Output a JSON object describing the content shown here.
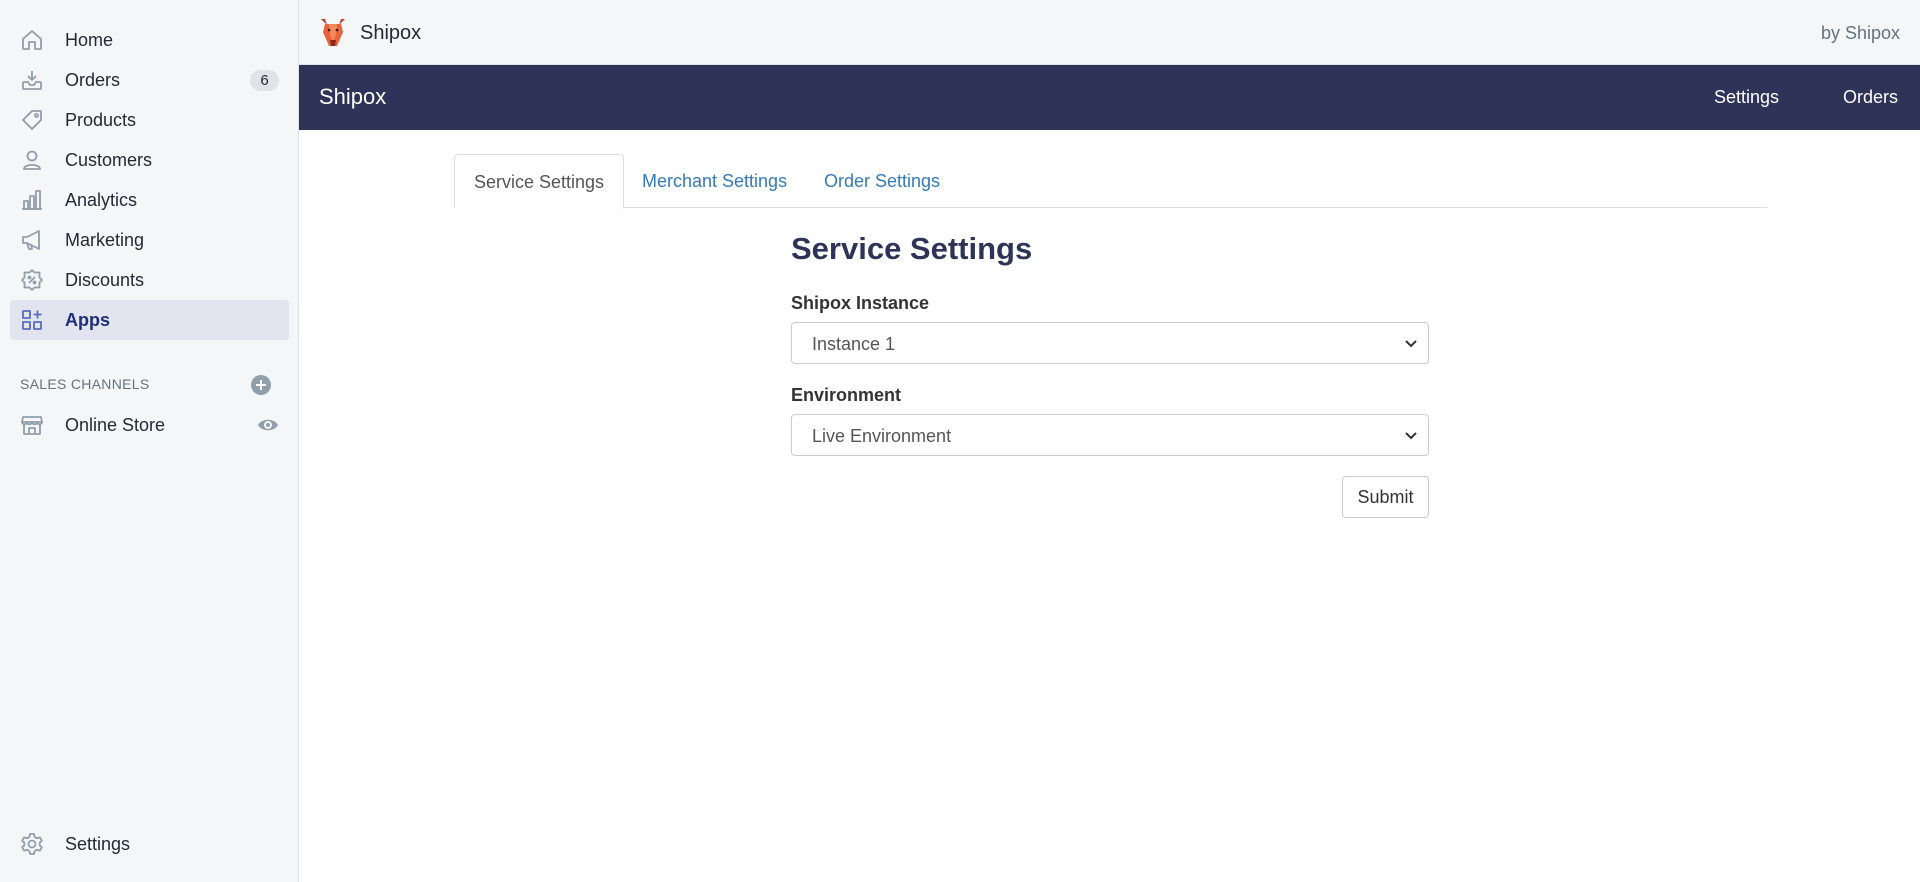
{
  "sidebar": {
    "items": [
      {
        "label": "Home",
        "icon": "home-icon"
      },
      {
        "label": "Orders",
        "icon": "orders-icon",
        "badge": "6"
      },
      {
        "label": "Products",
        "icon": "tag-icon"
      },
      {
        "label": "Customers",
        "icon": "person-icon"
      },
      {
        "label": "Analytics",
        "icon": "bar-chart-icon"
      },
      {
        "label": "Marketing",
        "icon": "megaphone-icon"
      },
      {
        "label": "Discounts",
        "icon": "discount-icon"
      },
      {
        "label": "Apps",
        "icon": "apps-icon",
        "active": true
      }
    ],
    "sales_channels": {
      "title": "SALES CHANNELS",
      "items": [
        {
          "label": "Online Store",
          "icon": "store-icon"
        }
      ]
    },
    "settings_label": "Settings"
  },
  "topbar": {
    "app_name": "Shipox",
    "by_label": "by Shipox"
  },
  "appbar": {
    "brand": "Shipox",
    "links": [
      "Settings",
      "Orders"
    ]
  },
  "tabs": [
    {
      "label": "Service Settings",
      "active": true
    },
    {
      "label": "Merchant Settings"
    },
    {
      "label": "Order Settings"
    }
  ],
  "form": {
    "title": "Service Settings",
    "instance_label": "Shipox Instance",
    "instance_value": "Instance 1",
    "environment_label": "Environment",
    "environment_value": "Live Environment",
    "submit_label": "Submit"
  },
  "colors": {
    "accent_dark": "#2e3457",
    "link": "#337ab7",
    "active_nav_bg": "#e2e5f0",
    "active_nav_text": "#202e78"
  }
}
